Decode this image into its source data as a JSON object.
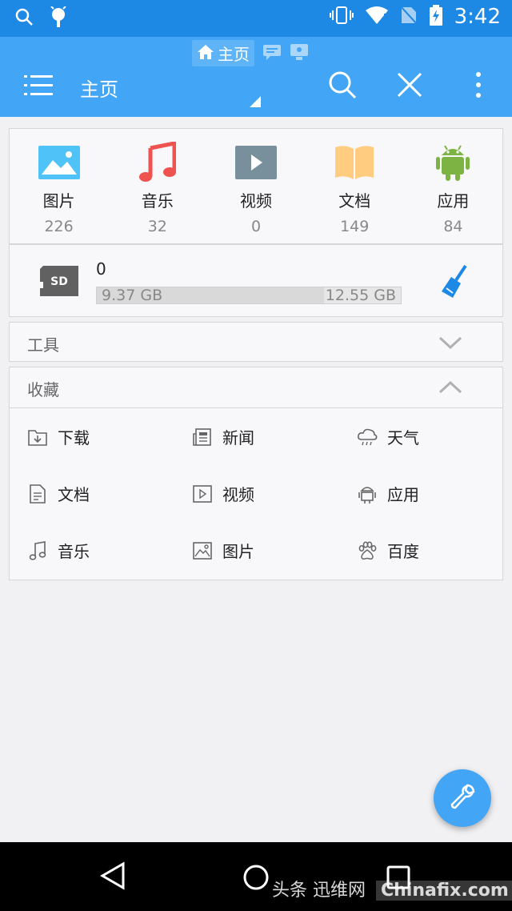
{
  "status_bar": {
    "time": "3:42"
  },
  "toolbar": {
    "tab_label": "主页",
    "title": "主页"
  },
  "categories": [
    {
      "label": "图片",
      "count": "226",
      "icon": "image-icon",
      "color": "#4fc3f7"
    },
    {
      "label": "音乐",
      "count": "32",
      "icon": "music-icon",
      "color": "#ef5350"
    },
    {
      "label": "视频",
      "count": "0",
      "icon": "video-icon",
      "color": "#78909c"
    },
    {
      "label": "文档",
      "count": "149",
      "icon": "book-icon",
      "color": "#ffcc80"
    },
    {
      "label": "应用",
      "count": "84",
      "icon": "android-icon",
      "color": "#7cb342"
    }
  ],
  "storage": {
    "name": "0",
    "used": "9.37 GB",
    "total": "12.55 GB",
    "used_fraction": 0.747
  },
  "sections": {
    "tools": "工具",
    "favorites": "收藏"
  },
  "favorites": [
    {
      "label": "下载",
      "icon": "download-folder-icon"
    },
    {
      "label": "新闻",
      "icon": "news-icon"
    },
    {
      "label": "天气",
      "icon": "weather-icon"
    },
    {
      "label": "文档",
      "icon": "document-icon"
    },
    {
      "label": "视频",
      "icon": "video-file-icon"
    },
    {
      "label": "应用",
      "icon": "app-icon"
    },
    {
      "label": "音乐",
      "icon": "music-note-icon"
    },
    {
      "label": "图片",
      "icon": "picture-icon"
    },
    {
      "label": "百度",
      "icon": "baidu-paw-icon"
    }
  ],
  "watermark": {
    "text": "头条 迅维网",
    "site": "Chinafix.com"
  },
  "colors": {
    "status_bar": "#1e88e5",
    "toolbar": "#42a5f5",
    "fab": "#42a5f5",
    "clean_icon": "#1e88e5"
  }
}
